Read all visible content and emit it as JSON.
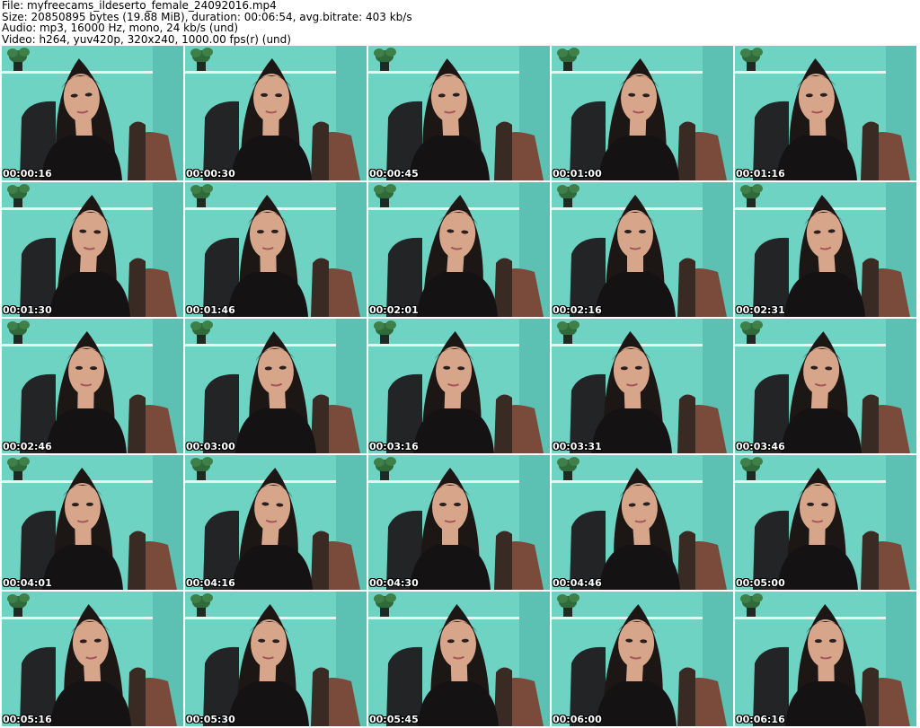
{
  "header": {
    "file_line": "File: myfreecams_ildeserto_female_24092016.mp4",
    "size_line": "Size: 20850895 bytes (19.88 MiB), duration: 00:06:54, avg.bitrate: 403 kb/s",
    "audio_line": "Audio: mp3, 16000 Hz, mono, 24 kb/s (und)",
    "video_line": "Video: h264, yuv420p, 320x240, 1000.00 fps(r) (und)"
  },
  "thumbnails": [
    {
      "timestamp": "00:00:16"
    },
    {
      "timestamp": "00:00:30"
    },
    {
      "timestamp": "00:00:45"
    },
    {
      "timestamp": "00:01:00"
    },
    {
      "timestamp": "00:01:16"
    },
    {
      "timestamp": "00:01:30"
    },
    {
      "timestamp": "00:01:46"
    },
    {
      "timestamp": "00:02:01"
    },
    {
      "timestamp": "00:02:16"
    },
    {
      "timestamp": "00:02:31"
    },
    {
      "timestamp": "00:02:46"
    },
    {
      "timestamp": "00:03:00"
    },
    {
      "timestamp": "00:03:16"
    },
    {
      "timestamp": "00:03:31"
    },
    {
      "timestamp": "00:03:46"
    },
    {
      "timestamp": "00:04:01"
    },
    {
      "timestamp": "00:04:16"
    },
    {
      "timestamp": "00:04:30"
    },
    {
      "timestamp": "00:04:46"
    },
    {
      "timestamp": "00:05:00"
    },
    {
      "timestamp": "00:05:16"
    },
    {
      "timestamp": "00:05:30"
    },
    {
      "timestamp": "00:05:45"
    },
    {
      "timestamp": "00:06:00"
    },
    {
      "timestamp": "00:06:16"
    }
  ],
  "colors": {
    "wall": "#6fd3c4",
    "shelf": "#e8f2ee",
    "hair": "#1c1614",
    "skin": "#d7a58a",
    "dress": "#141213",
    "chair": "#222426",
    "cushion": "#7a4a3a",
    "plant": "#2f6a3a"
  }
}
